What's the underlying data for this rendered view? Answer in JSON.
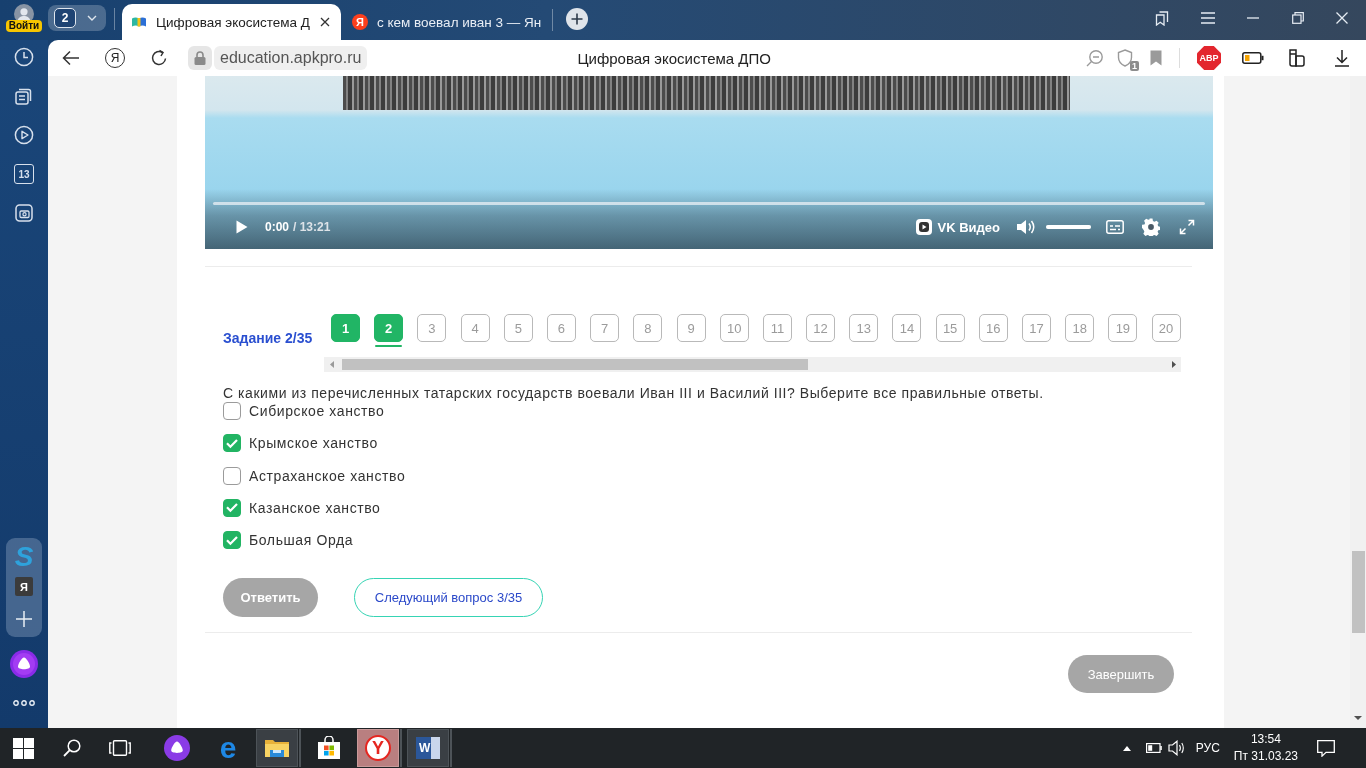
{
  "browser": {
    "profile": {
      "label": "Войти"
    },
    "tab_group": {
      "count": "2"
    },
    "tabs": [
      {
        "kind": "site",
        "title": "Цифровая экосистема Д",
        "selected": true
      },
      {
        "kind": "search",
        "favicon": "Я",
        "title": "с кем воевал иван 3 — Ян",
        "selected": false
      }
    ]
  },
  "toolbar": {
    "yandex_button": "Я",
    "url": "education.apkpro.ru",
    "page_title": "Цифровая экосистема ДПО",
    "protect_count": "1",
    "adblock_label": "ABP"
  },
  "sidebar": {
    "calendar_day": "13",
    "panel": {
      "logo": "S",
      "app": "Я"
    }
  },
  "video": {
    "current_time": "0:00",
    "total_time": "/ 13:21",
    "brand": "VK Видео",
    "volume": {
      "level": 1
    }
  },
  "quiz": {
    "task_label": "Задание 2/35",
    "pages": [
      {
        "label": "1",
        "answered": true,
        "selected": false
      },
      {
        "label": "2",
        "answered": true,
        "selected": true
      },
      {
        "label": "3",
        "answered": false,
        "selected": false
      },
      {
        "label": "4",
        "answered": false,
        "selected": false
      },
      {
        "label": "5",
        "answered": false,
        "selected": false
      },
      {
        "label": "6",
        "answered": false,
        "selected": false
      },
      {
        "label": "7",
        "answered": false,
        "selected": false
      },
      {
        "label": "8",
        "answered": false,
        "selected": false
      },
      {
        "label": "9",
        "answered": false,
        "selected": false
      },
      {
        "label": "10",
        "answered": false,
        "selected": false
      },
      {
        "label": "11",
        "answered": false,
        "selected": false
      },
      {
        "label": "12",
        "answered": false,
        "selected": false
      },
      {
        "label": "13",
        "answered": false,
        "selected": false
      },
      {
        "label": "14",
        "answered": false,
        "selected": false
      },
      {
        "label": "15",
        "answered": false,
        "selected": false
      },
      {
        "label": "16",
        "answered": false,
        "selected": false
      },
      {
        "label": "17",
        "answered": false,
        "selected": false
      },
      {
        "label": "18",
        "answered": false,
        "selected": false
      },
      {
        "label": "19",
        "answered": false,
        "selected": false
      },
      {
        "label": "20",
        "answered": false,
        "selected": false
      }
    ],
    "question": "С какими из перечисленных татарских государств воевали Иван III и Василий III? Выберите все правильные ответы.",
    "options": [
      {
        "label": "Сибирское ханство",
        "checked": false
      },
      {
        "label": "Крымское ханство",
        "checked": true
      },
      {
        "label": "Астраханское ханство",
        "checked": false
      },
      {
        "label": "Казанское ханство",
        "checked": true
      },
      {
        "label": "Большая Орда",
        "checked": true
      }
    ],
    "actions": [
      {
        "label": "Ответить",
        "kind": "filled",
        "disabled": true
      },
      {
        "label": "Следующий вопрос 3/35",
        "kind": "outline",
        "disabled": false
      }
    ],
    "finish": {
      "label": "Завершить",
      "disabled": true
    }
  },
  "taskbar": {
    "apps": [
      {
        "kind": "alice",
        "open": false,
        "active": false
      },
      {
        "kind": "edge",
        "glyph": "e",
        "open": false,
        "active": false
      },
      {
        "kind": "explorer",
        "open": true,
        "active": false
      },
      {
        "kind": "store",
        "open": false,
        "active": false
      },
      {
        "kind": "yandex",
        "glyph": "Y",
        "open": true,
        "active": true
      },
      {
        "kind": "word",
        "glyph": "W",
        "open": true,
        "active": false
      }
    ],
    "language": "РУС",
    "time": "13:54",
    "date": "Пт 31.03.23"
  }
}
